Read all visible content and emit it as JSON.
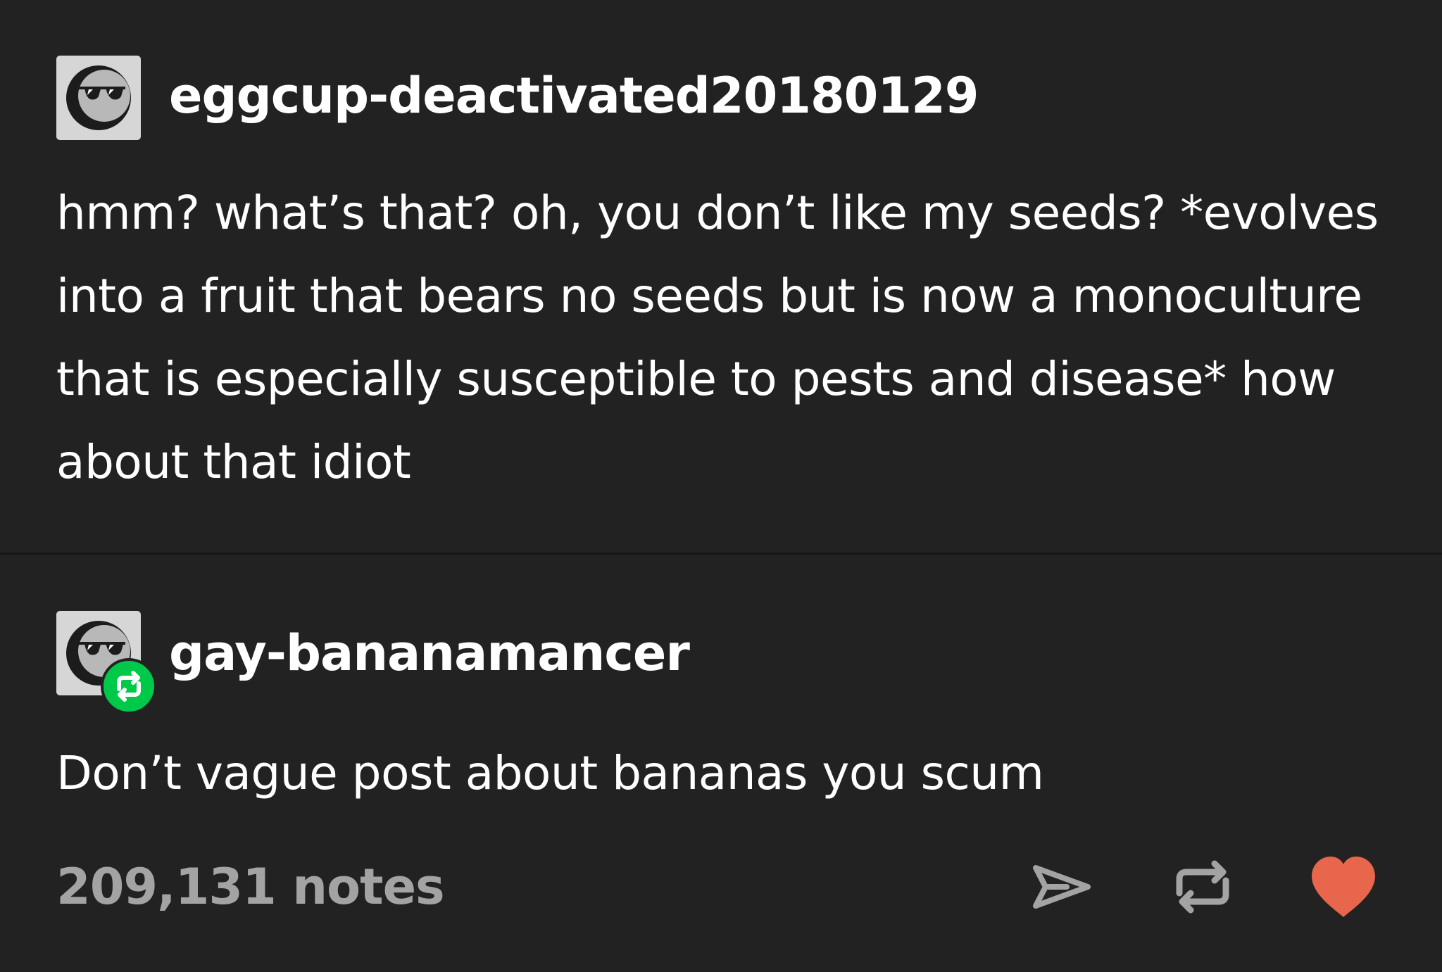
{
  "post": {
    "trail": [
      {
        "username": "eggcup-deactivated20180129",
        "avatar_icon": "sunglasses-avatar-icon",
        "text": "hmm? what’s that? oh, you don’t like my seeds? *evolves into a fruit that bears no seeds but is now a monoculture that is especially susceptible to pests and disease* how about that idiot"
      },
      {
        "username": "gay-bananamancer",
        "avatar_icon": "sunglasses-avatar-icon",
        "badge_icon": "reblog-icon",
        "text": "Don’t vague post about bananas you scum"
      }
    ],
    "footer": {
      "notes_label": "209,131 notes",
      "actions": [
        {
          "name": "share",
          "icon": "share-icon"
        },
        {
          "name": "reblog",
          "icon": "reblog-icon"
        },
        {
          "name": "like",
          "icon": "heart-icon",
          "color": "#e8664b"
        }
      ]
    }
  },
  "colors": {
    "background": "#222222",
    "text": "#ffffff",
    "muted": "#a3a3a3",
    "reblog_badge": "#00c94a",
    "like": "#e8664b"
  }
}
